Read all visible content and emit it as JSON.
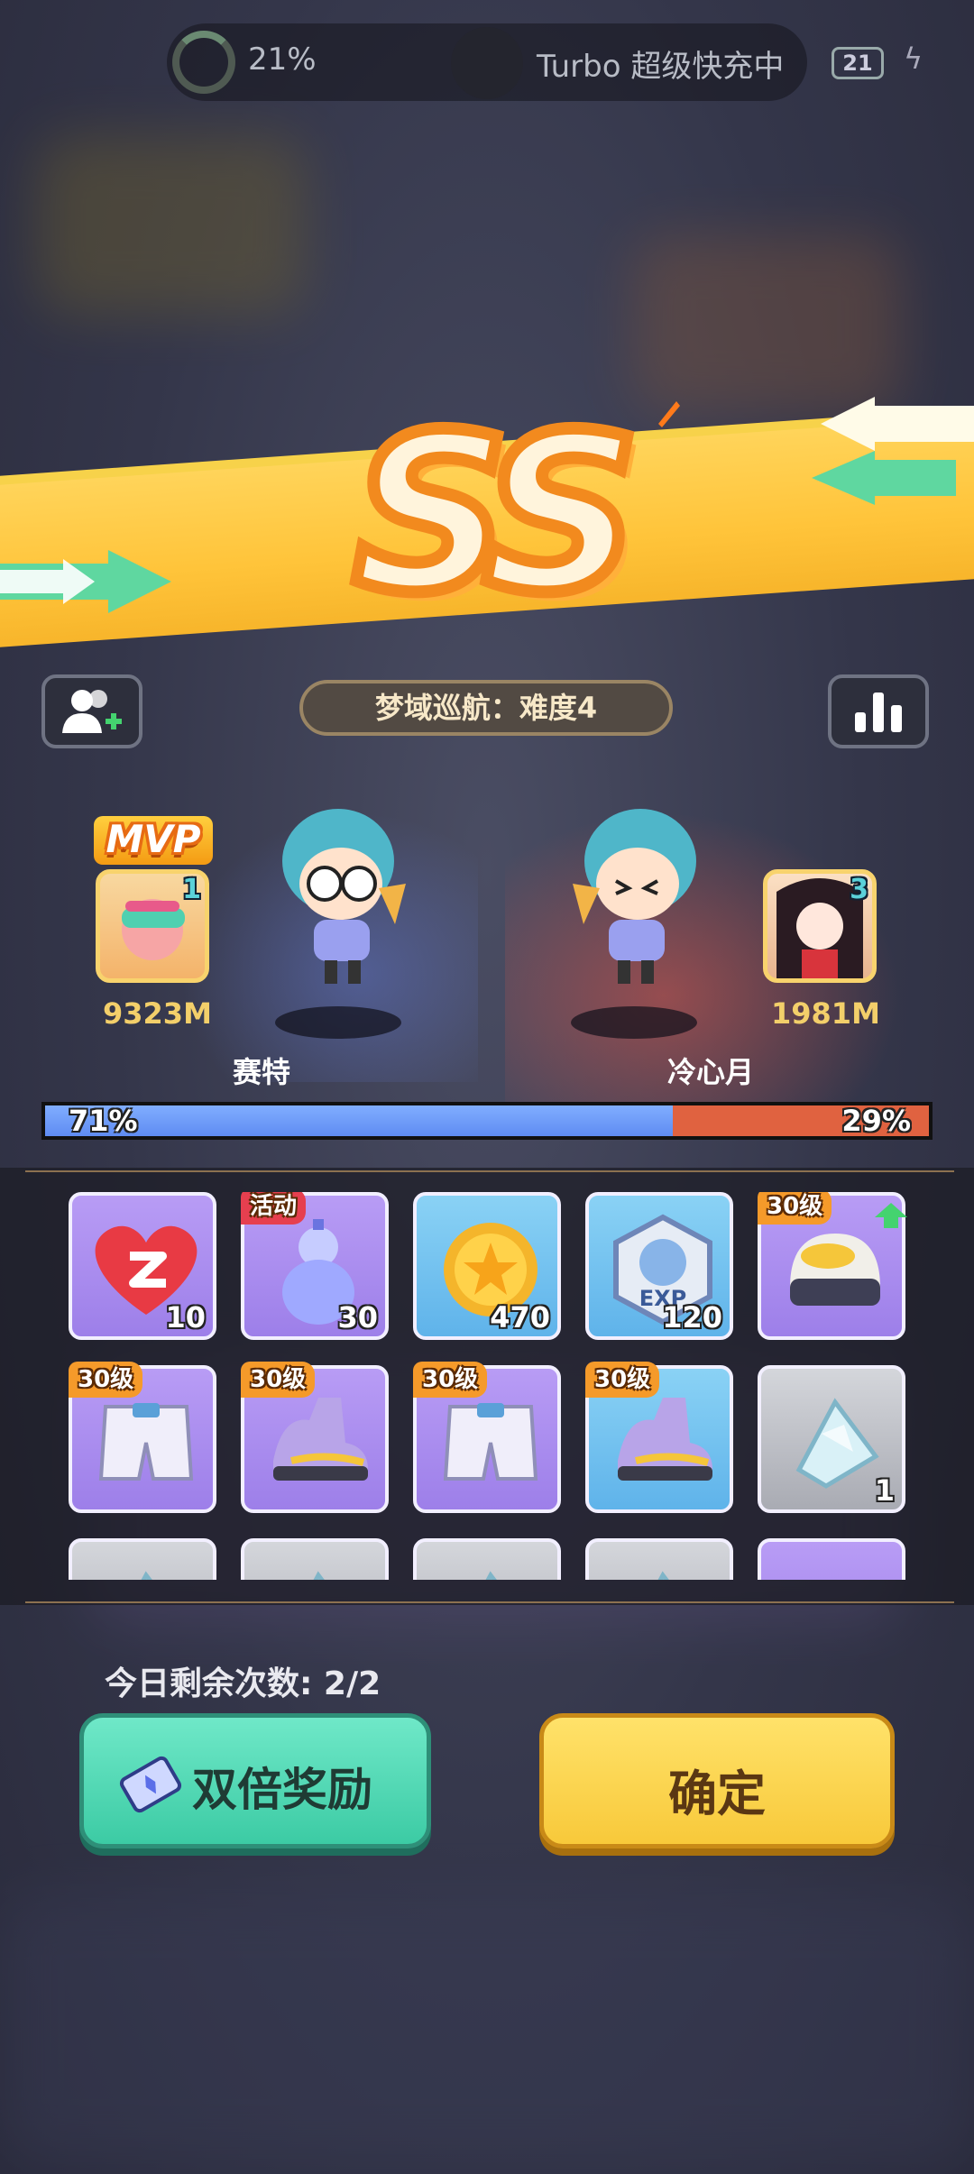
{
  "status_bar": {
    "battery_percent_text": "21%",
    "charging_text": "Turbo 超级快充中",
    "battery_level": "21"
  },
  "result": {
    "grade": "SS",
    "stage_title": "梦域巡航：难度4"
  },
  "players": {
    "left": {
      "badge": "MVP",
      "rank": "1",
      "distance": "9323M",
      "name": "赛特"
    },
    "right": {
      "rank": "3",
      "distance": "1981M",
      "name": "冷心月"
    }
  },
  "ratio": {
    "left_pct_text": "71%",
    "right_pct_text": "29%",
    "left_fraction": 0.71
  },
  "rewards": [
    {
      "icon": "heart-z-icon",
      "qty": "10",
      "bg": "purple"
    },
    {
      "icon": "gourd-icon",
      "qty": "30",
      "tag": "活动",
      "tag_color": "red",
      "bg": "purple"
    },
    {
      "icon": "gold-coin-icon",
      "qty": "470",
      "bg": "blue"
    },
    {
      "icon": "exp-badge-icon",
      "qty": "120",
      "bg": "blue"
    },
    {
      "icon": "helmet-icon",
      "tag": "30级",
      "tag_color": "orange",
      "bg": "purple",
      "upgrade": true
    },
    {
      "icon": "shorts-icon",
      "tag": "30级",
      "tag_color": "orange",
      "bg": "purple"
    },
    {
      "icon": "sneaker-icon",
      "tag": "30级",
      "tag_color": "orange",
      "bg": "purple"
    },
    {
      "icon": "shorts-icon",
      "tag": "30级",
      "tag_color": "orange",
      "bg": "purple"
    },
    {
      "icon": "sneaker-icon",
      "tag": "30级",
      "tag_color": "orange",
      "bg": "blue"
    },
    {
      "icon": "crystal-shard-icon",
      "qty": "1",
      "bg": "gray"
    },
    {
      "icon": "crystal-shard-icon",
      "bg": "gray"
    },
    {
      "icon": "crystal-shard-icon",
      "bg": "gray"
    },
    {
      "icon": "crystal-shard-icon",
      "bg": "gray"
    },
    {
      "icon": "crystal-shard-icon",
      "bg": "gray"
    },
    {
      "icon": "item-icon",
      "bg": "purple"
    }
  ],
  "footer": {
    "remaining_label": "今日剩余次数: 2/2",
    "double_reward_label": "双倍奖励",
    "confirm_label": "确定"
  },
  "colors": {
    "banner": "#ffc43a",
    "ratio_blue": "#6f9cf8",
    "ratio_red": "#e06240",
    "double_btn": "#4fd8b4",
    "confirm_btn": "#fbd24c"
  }
}
